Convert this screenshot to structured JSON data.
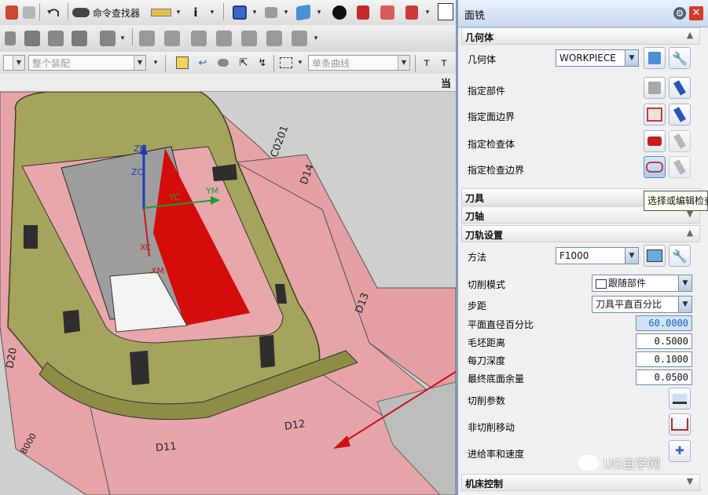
{
  "toolbar": {
    "command_finder_label": "命令查找器",
    "assembly_filter": "整个装配",
    "curve_rule": "单条曲线"
  },
  "viewport": {
    "status_right": "当",
    "axis_labels": {
      "zm": "ZM",
      "zc": "ZC",
      "yc": "YC",
      "ym": "YM",
      "xc": "XC",
      "xm": "XM"
    },
    "part_labels": {
      "c0201": "C0201",
      "d14": "D14",
      "d13": "D13",
      "d12": "D12",
      "d11": "D11",
      "d20": "D20",
      "b000": "B000"
    }
  },
  "dialog": {
    "title": "面铣",
    "sections": {
      "geometry": "几何体",
      "tool": "刀具",
      "tool_axis": "刀轴",
      "path_settings": "刀轨设置",
      "machine_control": "机床控制"
    },
    "geometry": {
      "geometry_label": "几何体",
      "geometry_value": "WORKPIECE",
      "specify_part": "指定部件",
      "specify_face_boundary": "指定面边界",
      "specify_check_body": "指定检查体",
      "specify_check_boundary": "指定检查边界"
    },
    "tooltip": "选择或编辑检查",
    "path": {
      "method_label": "方法",
      "method_value": "F1000",
      "cut_pattern_label": "切削模式",
      "cut_pattern_value": "跟随部件",
      "stepover_label": "步距",
      "stepover_value": "刀具平直百分比",
      "flat_diameter_pct_label": "平面直径百分比",
      "flat_diameter_pct_value": "60.0000",
      "blank_distance_label": "毛坯距离",
      "blank_distance_value": "0.5000",
      "depth_per_cut_label": "每刀深度",
      "depth_per_cut_value": "0.1000",
      "final_floor_stock_label": "最终底面余量",
      "final_floor_stock_value": "0.0500",
      "cutting_params_label": "切削参数",
      "non_cutting_moves_label": "非切削移动",
      "feeds_speeds_label": "进给率和速度"
    }
  },
  "watermark": "UG自学网",
  "colors": {
    "part": "#a4a45c",
    "pink": "#e8a7ab",
    "red": "#d40c0c",
    "grey": "#9d9d9d",
    "dialog_bg": "#f0f0f0",
    "highlight": "#cfe3fb"
  }
}
